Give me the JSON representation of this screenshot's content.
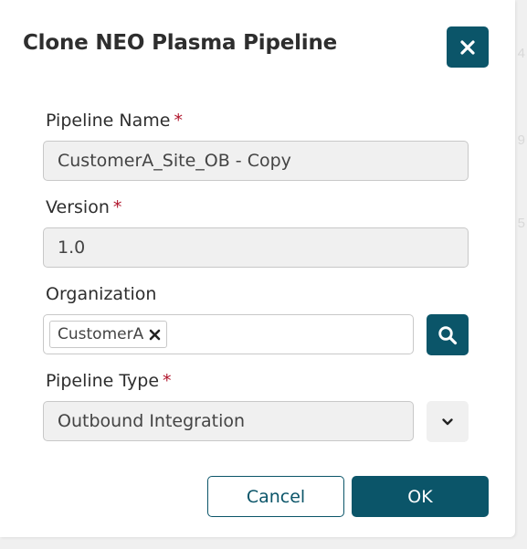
{
  "dialog": {
    "title": "Clone NEO Plasma Pipeline",
    "close_icon": "close-icon"
  },
  "form": {
    "pipeline_name": {
      "label": "Pipeline Name",
      "required_mark": "*",
      "value": "CustomerA_Site_OB - Copy"
    },
    "version": {
      "label": "Version",
      "required_mark": "*",
      "value": "1.0"
    },
    "organization": {
      "label": "Organization",
      "chips": [
        "CustomerA"
      ],
      "search_icon": "search-icon",
      "remove_icon": "close-icon"
    },
    "pipeline_type": {
      "label": "Pipeline Type",
      "required_mark": "*",
      "value": "Outbound Integration",
      "dropdown_icon": "chevron-down-icon"
    }
  },
  "footer": {
    "cancel_label": "Cancel",
    "ok_label": "OK"
  },
  "background": {
    "digits": [
      "4",
      "9",
      "5"
    ]
  },
  "colors": {
    "accent": "#0b5569",
    "required": "#b0142b",
    "field_bg": "#f0f0f0"
  }
}
